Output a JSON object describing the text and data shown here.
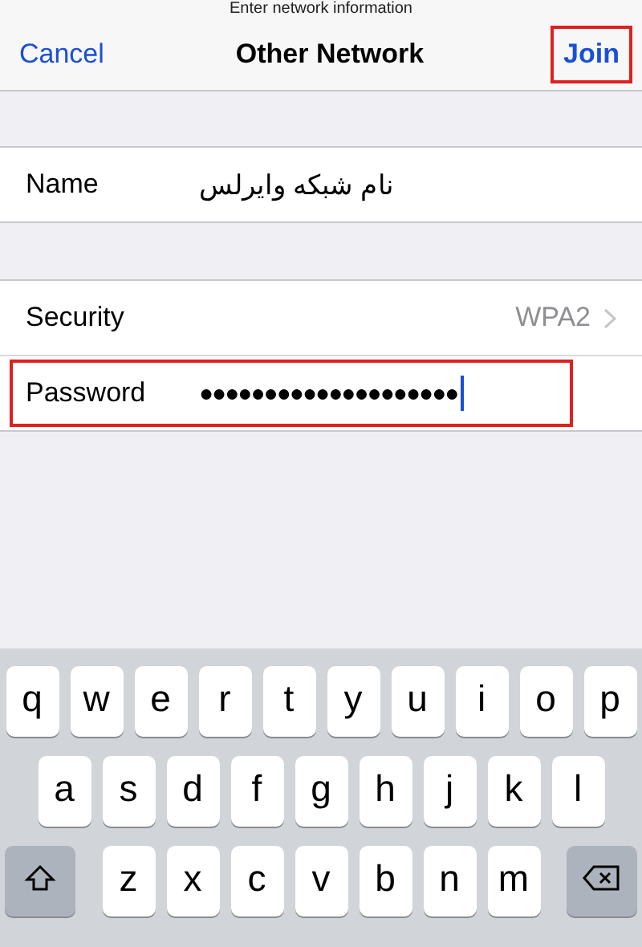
{
  "prompt": "Enter network information",
  "nav": {
    "cancel": "Cancel",
    "title": "Other Network",
    "join": {
      "label": "Join",
      "highlighted": true
    }
  },
  "groups": [
    {
      "rows": [
        {
          "kind": "text",
          "label": "Name",
          "value": "نام شبکه وایرلس",
          "highlighted": false
        }
      ]
    },
    {
      "rows": [
        {
          "kind": "detail",
          "label": "Security",
          "value": "WPA2",
          "highlighted": false
        },
        {
          "kind": "secure",
          "label": "Password",
          "value": "●●●●●●●●●●●●●●●●●●●●",
          "highlighted": true,
          "focused": true
        }
      ]
    }
  ],
  "keyboard": [
    {
      "keys": [
        {
          "kind": "letter",
          "label": "q"
        },
        {
          "kind": "letter",
          "label": "w"
        },
        {
          "kind": "letter",
          "label": "e"
        },
        {
          "kind": "letter",
          "label": "r"
        },
        {
          "kind": "letter",
          "label": "t"
        },
        {
          "kind": "letter",
          "label": "y"
        },
        {
          "kind": "letter",
          "label": "u"
        },
        {
          "kind": "letter",
          "label": "i"
        },
        {
          "kind": "letter",
          "label": "o"
        },
        {
          "kind": "letter",
          "label": "p"
        }
      ]
    },
    {
      "keys": [
        {
          "kind": "letter",
          "label": "a"
        },
        {
          "kind": "letter",
          "label": "s"
        },
        {
          "kind": "letter",
          "label": "d"
        },
        {
          "kind": "letter",
          "label": "f"
        },
        {
          "kind": "letter",
          "label": "g"
        },
        {
          "kind": "letter",
          "label": "h"
        },
        {
          "kind": "letter",
          "label": "j"
        },
        {
          "kind": "letter",
          "label": "k"
        },
        {
          "kind": "letter",
          "label": "l"
        }
      ]
    },
    {
      "keys": [
        {
          "kind": "shift"
        },
        {
          "kind": "letter",
          "label": "z"
        },
        {
          "kind": "letter",
          "label": "x"
        },
        {
          "kind": "letter",
          "label": "c"
        },
        {
          "kind": "letter",
          "label": "v"
        },
        {
          "kind": "letter",
          "label": "b"
        },
        {
          "kind": "letter",
          "label": "n"
        },
        {
          "kind": "letter",
          "label": "m"
        },
        {
          "kind": "delete"
        }
      ]
    }
  ]
}
